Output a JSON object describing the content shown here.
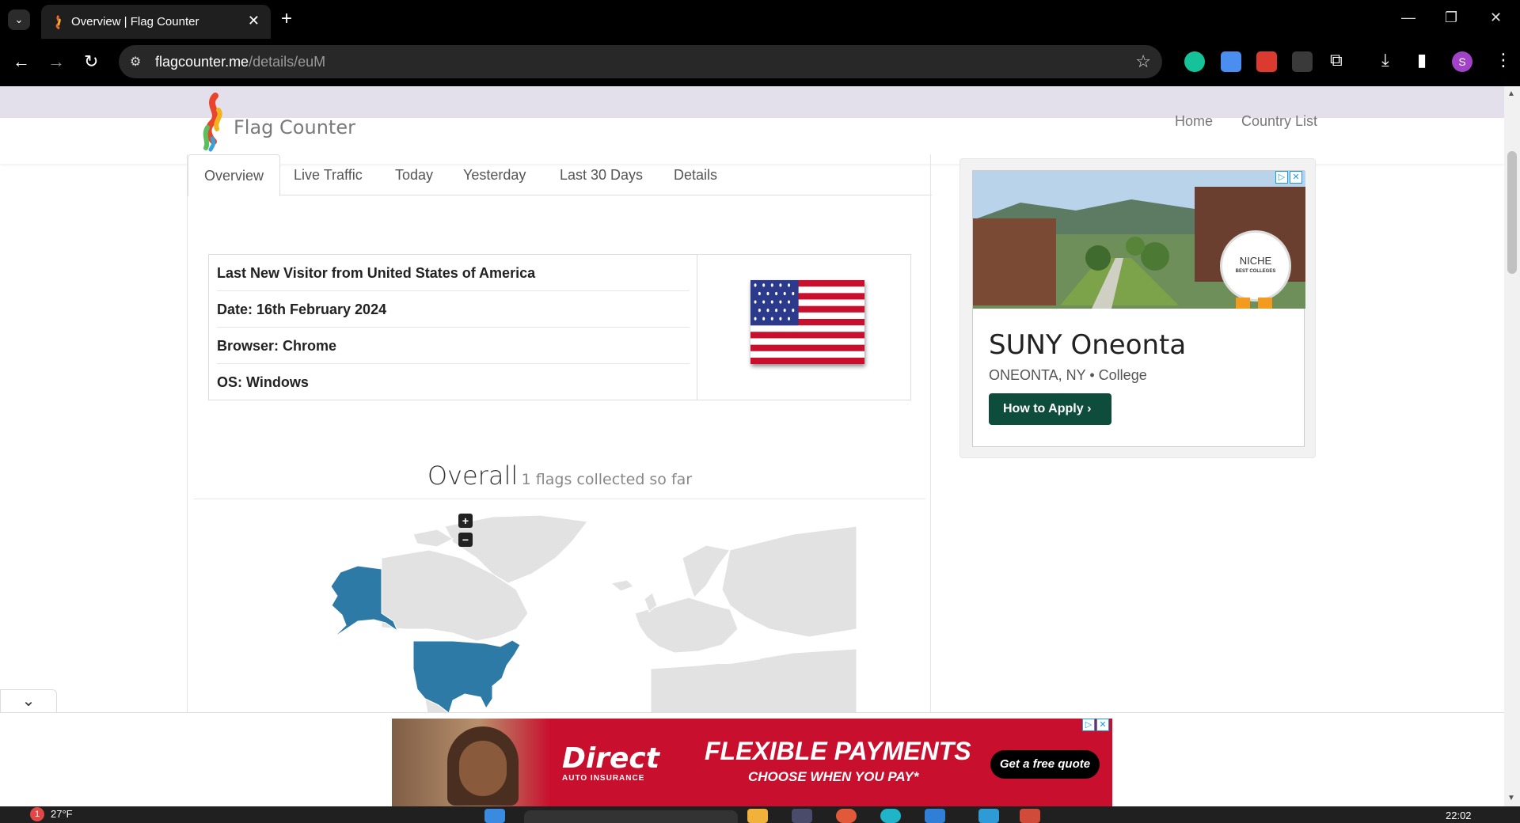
{
  "browser": {
    "tab_title": "Overview | Flag Counter",
    "url_domain": "flagcounter.me",
    "url_path": "/details/euM",
    "profile_initial": "S"
  },
  "site": {
    "logo_text": "Flag Counter",
    "nav": [
      "Home",
      "Country List"
    ]
  },
  "tabs": [
    "Overview",
    "Live Traffic",
    "Today",
    "Yesterday",
    "Last 30 Days",
    "Details"
  ],
  "visitor": {
    "rows": [
      "Last New Visitor from United States of America",
      "Date: 16th February 2024",
      "Browser: Chrome",
      "OS: Windows"
    ]
  },
  "overall": {
    "title": "Overall",
    "subtitle": "1 flags collected so far"
  },
  "map": {
    "zoom_in": "+",
    "zoom_out": "−",
    "highlight_color": "#2e7aa6",
    "land_color": "#e2e2e2"
  },
  "side_ad": {
    "name": "SUNY Oneonta",
    "location": "ONEONTA, NY",
    "type": "College",
    "cta": "How to Apply",
    "badge_text": "NICHE",
    "badge_sub": "BEST COLLEGES"
  },
  "bottom_ad": {
    "brand": "Direct",
    "brand_sub": "AUTO INSURANCE",
    "headline": "FLEXIBLE PAYMENTS",
    "subline": "CHOOSE WHEN YOU PAY*",
    "cta": "Get a free quote"
  },
  "taskbar": {
    "weather": "27°F",
    "badge": "1",
    "time": "22:02"
  }
}
